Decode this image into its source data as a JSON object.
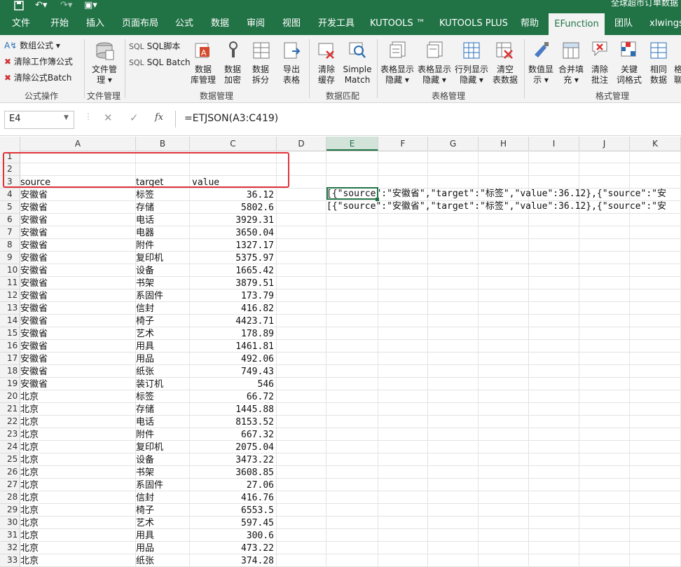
{
  "titlebar": {
    "title": "全球超市订单数据"
  },
  "menu_tabs": [
    "文件",
    "开始",
    "插入",
    "页面布局",
    "公式",
    "数据",
    "审阅",
    "视图",
    "开发工具",
    "KUTOOLS ™",
    "KUTOOLS PLUS",
    "帮助",
    "EFunction",
    "团队",
    "xlwings"
  ],
  "active_tab": "EFunction",
  "ribbon": {
    "formula_ops": {
      "item1": "数组公式",
      "item2": "清除工作簿公式",
      "item3": "清除公式Batch",
      "group": "公式操作"
    },
    "file_mgmt": {
      "btn_line1": "文件管",
      "btn_line2": "理",
      "group": "文件管理"
    },
    "sql": {
      "item1": "SQL脚本",
      "item2": "SQL Batch"
    },
    "data_mgmt": {
      "btn1": [
        "数据",
        "库管理"
      ],
      "btn2": [
        "数据",
        "加密"
      ],
      "btn3": [
        "数据",
        "拆分"
      ],
      "btn4": [
        "导出",
        "表格"
      ],
      "group": "数据管理"
    },
    "data_match": {
      "btn1": [
        "清除",
        "缓存"
      ],
      "btn2": [
        "Simple",
        "Match"
      ],
      "group": "数据匹配"
    },
    "table_mgmt": {
      "btn1": [
        "表格显示",
        "隐藏"
      ],
      "btn2": [
        "表格显示",
        "隐藏"
      ],
      "btn3": [
        "行列显示",
        "隐藏"
      ],
      "btn4": [
        "清空",
        "表数据"
      ],
      "group": "表格管理"
    },
    "format": {
      "btn1": [
        "数值显",
        "示"
      ],
      "btn2": [
        "合并填",
        "充"
      ],
      "btn3": [
        "清除",
        "批注"
      ],
      "btn4": [
        "关键",
        "词格式"
      ],
      "btn5": [
        "相同",
        "数据"
      ],
      "btn6": [
        "格",
        "聊"
      ],
      "group": "格式管理"
    }
  },
  "formula_bar": {
    "name_box": "E4",
    "fx": "fx",
    "formula": "=ETJSON(A3:C419)"
  },
  "columns": [
    "A",
    "B",
    "C",
    "D",
    "E",
    "F",
    "G",
    "H",
    "I",
    "J",
    "K"
  ],
  "selected_column": "E",
  "rows": [
    {
      "n": "1",
      "a": "",
      "b": "",
      "c": ""
    },
    {
      "n": "2",
      "a": "",
      "b": "",
      "c": ""
    },
    {
      "n": "3",
      "a": "source",
      "b": "target",
      "c": "value"
    },
    {
      "n": "4",
      "a": "安徽省",
      "b": "标签",
      "c": "36.12"
    },
    {
      "n": "5",
      "a": "安徽省",
      "b": "存储",
      "c": "5802.6"
    },
    {
      "n": "6",
      "a": "安徽省",
      "b": "电话",
      "c": "3929.31"
    },
    {
      "n": "7",
      "a": "安徽省",
      "b": "电器",
      "c": "3650.04"
    },
    {
      "n": "8",
      "a": "安徽省",
      "b": "附件",
      "c": "1327.17"
    },
    {
      "n": "9",
      "a": "安徽省",
      "b": "复印机",
      "c": "5375.97"
    },
    {
      "n": "10",
      "a": "安徽省",
      "b": "设备",
      "c": "1665.42"
    },
    {
      "n": "11",
      "a": "安徽省",
      "b": "书架",
      "c": "3879.51"
    },
    {
      "n": "12",
      "a": "安徽省",
      "b": "系固件",
      "c": "173.79"
    },
    {
      "n": "13",
      "a": "安徽省",
      "b": "信封",
      "c": "416.82"
    },
    {
      "n": "14",
      "a": "安徽省",
      "b": "椅子",
      "c": "4423.71"
    },
    {
      "n": "15",
      "a": "安徽省",
      "b": "艺术",
      "c": "178.89"
    },
    {
      "n": "16",
      "a": "安徽省",
      "b": "用具",
      "c": "1461.81"
    },
    {
      "n": "17",
      "a": "安徽省",
      "b": "用品",
      "c": "492.06"
    },
    {
      "n": "18",
      "a": "安徽省",
      "b": "纸张",
      "c": "749.43"
    },
    {
      "n": "19",
      "a": "安徽省",
      "b": "装订机",
      "c": "546"
    },
    {
      "n": "20",
      "a": "北京",
      "b": "标签",
      "c": "66.72"
    },
    {
      "n": "21",
      "a": "北京",
      "b": "存储",
      "c": "1445.88"
    },
    {
      "n": "22",
      "a": "北京",
      "b": "电话",
      "c": "8153.52"
    },
    {
      "n": "23",
      "a": "北京",
      "b": "附件",
      "c": "667.32"
    },
    {
      "n": "24",
      "a": "北京",
      "b": "复印机",
      "c": "2075.04"
    },
    {
      "n": "25",
      "a": "北京",
      "b": "设备",
      "c": "3473.22"
    },
    {
      "n": "26",
      "a": "北京",
      "b": "书架",
      "c": "3608.85"
    },
    {
      "n": "27",
      "a": "北京",
      "b": "系固件",
      "c": "27.06"
    },
    {
      "n": "28",
      "a": "北京",
      "b": "信封",
      "c": "416.76"
    },
    {
      "n": "29",
      "a": "北京",
      "b": "椅子",
      "c": "6553.5"
    },
    {
      "n": "30",
      "a": "北京",
      "b": "艺术",
      "c": "597.45"
    },
    {
      "n": "31",
      "a": "北京",
      "b": "用具",
      "c": "300.6"
    },
    {
      "n": "32",
      "a": "北京",
      "b": "用品",
      "c": "473.22"
    },
    {
      "n": "33",
      "a": "北京",
      "b": "纸张",
      "c": "374.28"
    }
  ],
  "e_cells": {
    "e4": "[{\"source\":\"安徽省\",\"target\":\"标签\",\"value\":36.12},{\"source\":\"安",
    "e5": "[{\"source\":\"安徽省\",\"target\":\"标签\",\"value\":36.12},{\"source\":\"安"
  }
}
